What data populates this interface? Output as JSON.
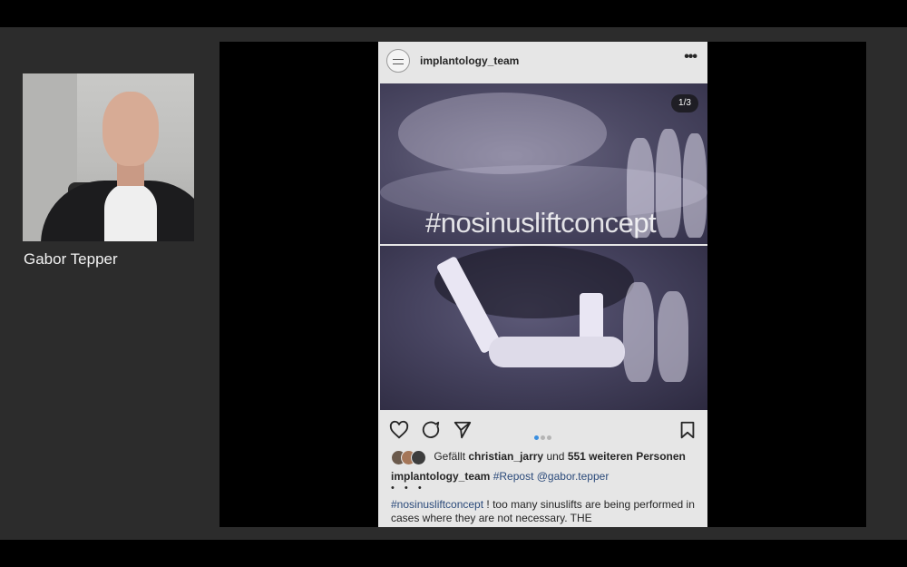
{
  "speaker": {
    "name": "Gabor Tepper"
  },
  "post": {
    "username": "implantology_team",
    "more": "•••",
    "image_counter": "1/3",
    "image_overlay_text": "#nosinusliftconcept",
    "likes": {
      "prefix": "Gefällt",
      "user": "christian_jarry",
      "middle": "und",
      "others": "551 weiteren Personen"
    },
    "caption": {
      "username": "implantology_team",
      "hashtag": "#Repost",
      "mention": "@gabor.tepper",
      "ellipsis": "• • •",
      "tag": "#nosinusliftconcept",
      "text": "! too many sinuslifts are being performed in cases where they are not necessary. THE"
    },
    "carousel": {
      "total": 3,
      "active": 1
    }
  },
  "icons": [
    "heart-icon",
    "comment-icon",
    "share-icon",
    "bookmark-icon",
    "more-icon"
  ],
  "colors": {
    "accent": "#3b8fe0",
    "link": "#2b4a7a",
    "background": "#2c2c2c"
  }
}
